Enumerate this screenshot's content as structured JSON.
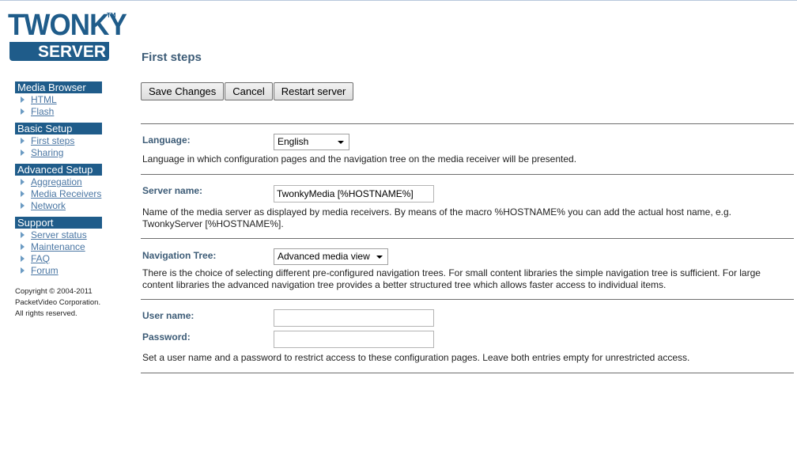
{
  "logo": {
    "top": "TWONKY",
    "tm": "TM",
    "bottom": "SERVER"
  },
  "sidebar": {
    "groups": [
      {
        "title": "Media Browser",
        "items": [
          "HTML",
          "Flash"
        ]
      },
      {
        "title": "Basic Setup",
        "items": [
          "First steps",
          "Sharing"
        ]
      },
      {
        "title": "Advanced Setup",
        "items": [
          "Aggregation",
          "Media Receivers",
          "Network"
        ]
      },
      {
        "title": "Support",
        "items": [
          "Server status",
          "Maintenance",
          "FAQ",
          "Forum"
        ]
      }
    ],
    "copyright": [
      "Copyright © 2004-2011",
      "PacketVideo Corporation.",
      "All rights reserved."
    ]
  },
  "page": {
    "title": "First steps"
  },
  "toolbar": {
    "save": "Save Changes",
    "cancel": "Cancel",
    "restart": "Restart server"
  },
  "language": {
    "label": "Language:",
    "value": "English",
    "description": "Language in which configuration pages and the navigation tree on the media receiver will be presented."
  },
  "server_name": {
    "label": "Server name:",
    "value": "TwonkyMedia [%HOSTNAME%]",
    "description_1": "Name of the media server as displayed by media receivers. By means of the macro %HOSTNAME% you can add the actual host name, e.g.",
    "description_2": "TwonkyServer [%HOSTNAME%]."
  },
  "navigation": {
    "label": "Navigation Tree:",
    "value": "Advanced media view",
    "description_1": "There is the choice of selecting different pre-configured navigation trees. For small content libraries the simple navigation tree is sufficient. For large",
    "description_2": "content libraries the advanced navigation tree provides a better structured tree which allows faster access to individual items."
  },
  "credentials": {
    "user_label": "User name:",
    "user_value": "",
    "password_label": "Password:",
    "password_value": "",
    "description": "Set a user name and a password to restrict access to these configuration pages. Leave both entries empty for unrestricted access."
  },
  "colors": {
    "brand": "#1f5c8a",
    "link": "#4a76a3",
    "label": "#3d5c77"
  }
}
